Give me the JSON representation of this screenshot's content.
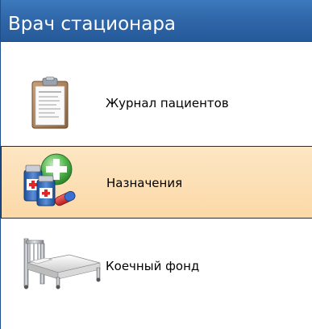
{
  "header": {
    "title": "Врач стационара",
    "background": "#2f66a8"
  },
  "nav": {
    "items": [
      {
        "label": "Журнал пациентов",
        "icon": "clipboard-icon",
        "selected": false
      },
      {
        "label": "Назначения",
        "icon": "medicine-icon",
        "selected": true
      },
      {
        "label": "Коечный фонд",
        "icon": "hospital-bed-icon",
        "selected": false
      }
    ],
    "selected_background": "#fbd9a8"
  }
}
